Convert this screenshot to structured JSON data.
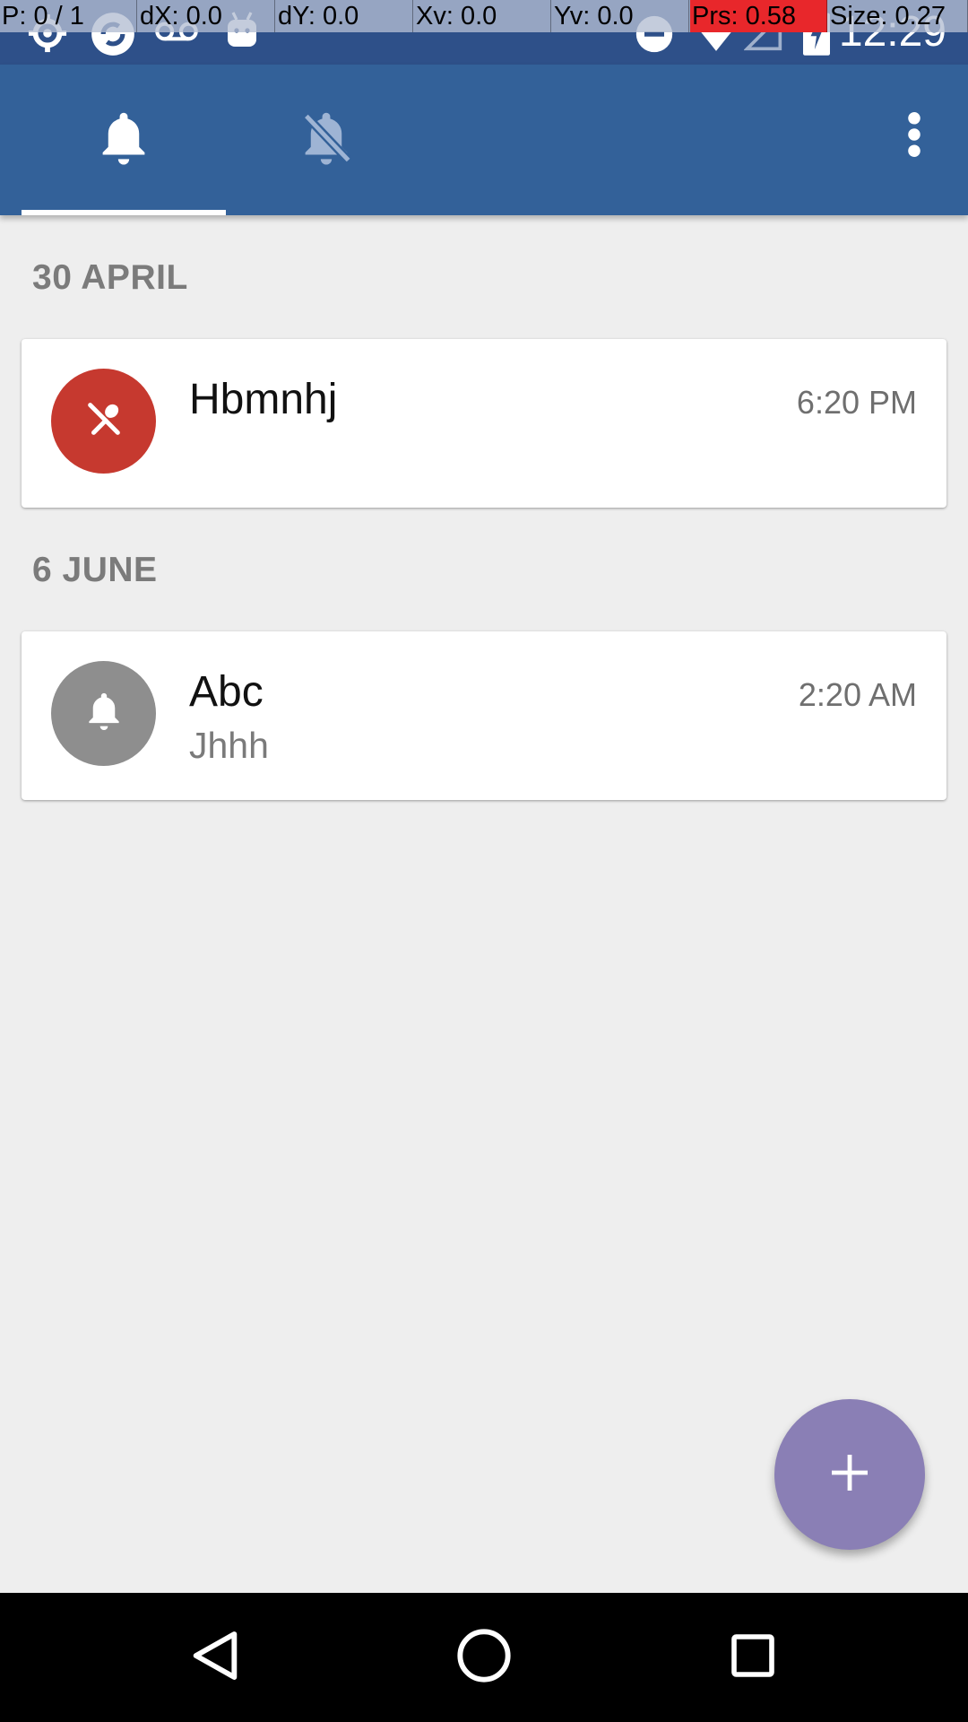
{
  "debug_overlay": {
    "pointer": "P: 0 / 1",
    "dx": "dX: 0.0",
    "dy": "dY: 0.0",
    "xv": "Xv: 0.0",
    "yv": "Yv: 0.0",
    "prs": "Prs: 0.58",
    "size": "Size: 0.27"
  },
  "status_bar": {
    "time": "12:29",
    "icons": [
      "settings-icon",
      "sync-icon",
      "voicemail-icon",
      "android-icon",
      "do-not-disturb-icon",
      "wifi-icon",
      "signal-icon",
      "battery-charging-icon"
    ]
  },
  "tabs": [
    {
      "icon": "bell-icon",
      "selected": true
    },
    {
      "icon": "bell-off-icon",
      "selected": false
    }
  ],
  "sections": [
    {
      "header": "30 APRIL",
      "items": [
        {
          "title": "Hbmnhj",
          "subtitle": "",
          "time": "6:20 PM",
          "icon": "fork-spoon-icon",
          "color": "#c6392f"
        }
      ]
    },
    {
      "header": "6 JUNE",
      "items": [
        {
          "title": "Abc",
          "subtitle": "Jhhh",
          "time": "2:20 AM",
          "icon": "bell-icon",
          "color": "#8e8e8e"
        }
      ]
    }
  ],
  "colors": {
    "app_bar": "#336199",
    "status_bar": "#2e5089",
    "fab": "#8a7fb5",
    "background": "#eeeeee"
  },
  "fab": {
    "icon": "plus-icon"
  },
  "nav_bar": [
    "back-icon",
    "home-icon",
    "recents-icon"
  ]
}
